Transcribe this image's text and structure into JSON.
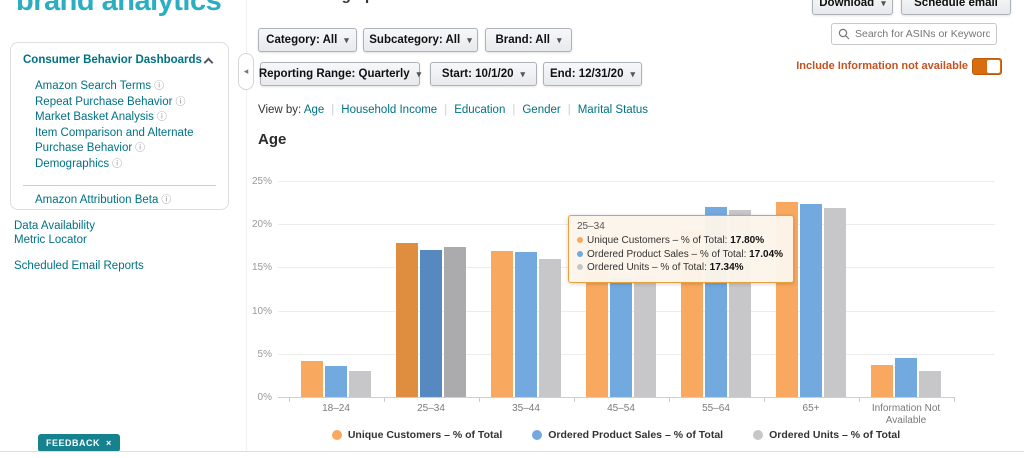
{
  "logo": "brand analytics",
  "top_cropped_heading": "Demographics",
  "icons": {
    "caret_down": "▾",
    "collapse_left": "◂",
    "info": "ⓘ",
    "search": "⌕"
  },
  "sidebar": {
    "header": "Consumer Behavior Dashboards",
    "items": [
      {
        "label": "Amazon Search Terms",
        "info": "ⓘ"
      },
      {
        "label": "Repeat Purchase Behavior",
        "info": "ⓘ"
      },
      {
        "label": "Market Basket Analysis",
        "info": "ⓘ"
      },
      {
        "label": "Item Comparison and Alternate Purchase Behavior",
        "info": "ⓘ"
      },
      {
        "label": "Demographics",
        "info": "ⓘ"
      }
    ],
    "beta_item": {
      "label": "Amazon Attribution Beta",
      "info": "ⓘ"
    },
    "links": [
      "Data Availability",
      "Metric Locator",
      "Scheduled Email Reports"
    ]
  },
  "header": {
    "download_label": "Download",
    "schedule_email_label": "Schedule email",
    "search_placeholder": "Search for ASINs or Keywords",
    "toggle_label": "Include Information not available",
    "toggle_state": "on"
  },
  "filters": {
    "row1": [
      "Category: All",
      "Subcategory: All",
      "Brand: All"
    ],
    "row2": [
      "Reporting Range: Quarterly",
      "Start: 10/1/20",
      "End: 12/31/20"
    ]
  },
  "viewby": {
    "label": "View by:",
    "options": [
      "Age",
      "Household Income",
      "Education",
      "Gender",
      "Marital Status"
    ]
  },
  "section_title": "Age",
  "chart_data": {
    "type": "bar",
    "title": "Age",
    "categories": [
      "18–24",
      "25–34",
      "35–44",
      "45–54",
      "55–64",
      "65+",
      "Information Not Available"
    ],
    "series": [
      {
        "key": "unique-customers",
        "name": "Unique Customers – % of Total",
        "color": "#F9A95F",
        "highlight_color": "#DF8D3E",
        "values": [
          4.2,
          17.8,
          16.9,
          14.7,
          19.3,
          22.6,
          3.7
        ]
      },
      {
        "key": "ordered-product-sales",
        "name": "Ordered Product Sales – % of Total",
        "color": "#72A9DE",
        "highlight_color": "#5589C0",
        "values": [
          3.6,
          17.04,
          16.8,
          13.8,
          22.0,
          22.3,
          4.5
        ]
      },
      {
        "key": "ordered-units",
        "name": "Ordered Units – % of Total",
        "color": "#C7C7C9",
        "highlight_color": "#ABABAD",
        "values": [
          3.0,
          17.34,
          16.0,
          14.0,
          21.6,
          21.9,
          3.0
        ]
      }
    ],
    "ylim": [
      0,
      25
    ],
    "yticks": [
      0,
      5,
      10,
      15,
      20,
      25
    ],
    "ytick_suffix": "%",
    "highlight_index": 1,
    "grid": true,
    "legend_position": "bottom"
  },
  "tooltip": {
    "title": "25–34",
    "rows": [
      {
        "label": "Unique Customers – % of Total",
        "value": "17.80%"
      },
      {
        "label": "Ordered Product Sales – % of Total",
        "value": "17.04%"
      },
      {
        "label": "Ordered Units – % of Total",
        "value": "17.34%"
      }
    ]
  },
  "feedback": {
    "label": "FEEDBACK",
    "close": "×"
  }
}
